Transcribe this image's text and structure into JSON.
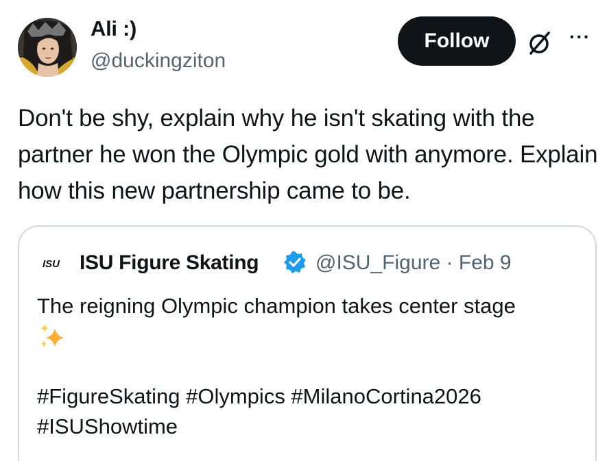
{
  "author": {
    "name": "Ali :)",
    "handle": "@duckingziton"
  },
  "actions": {
    "follow_label": "Follow",
    "grok_icon": "grok-slash-icon",
    "more_icon": "more-dots-icon",
    "more_glyph": "···"
  },
  "tweet": {
    "text": "Don't be shy, explain why he isn't skating with the partner he won the Olympic gold with anymore. Explain how this new partnership came to be."
  },
  "quote": {
    "logo_text": "ISU",
    "name": "ISU Figure Skating",
    "handle": "@ISU_Figure",
    "separator": "·",
    "date": "Feb 9",
    "text": "The reigning Olympic champion takes center stage",
    "hashtags_line1": "#FigureSkating #Olympics #MilanoCortina2026",
    "hashtags_line2": "#ISUShowtime"
  },
  "colors": {
    "text": "#0f1419",
    "secondary": "#536471",
    "border": "#cfd9de",
    "verified_blue": "#1d9bf0",
    "sparkle": "#ffac33",
    "follow_bg": "#0f1419"
  }
}
